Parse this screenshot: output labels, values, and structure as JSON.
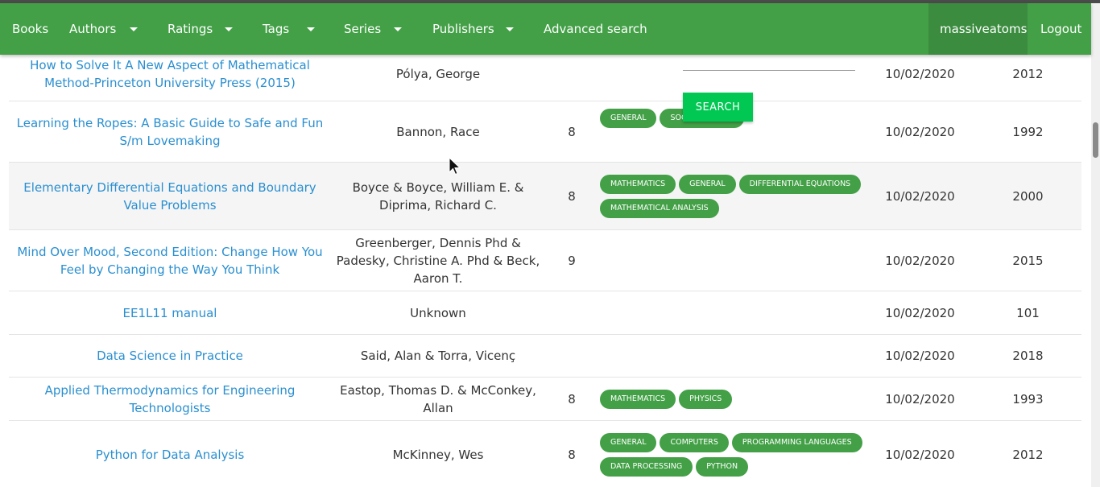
{
  "nav": {
    "books": "Books",
    "authors": "Authors",
    "ratings": "Ratings",
    "tags": "Tags",
    "series": "Series",
    "publishers": "Publishers",
    "advanced_search": "Advanced search",
    "user": "massiveatoms",
    "logout": "Logout"
  },
  "search": {
    "button_label": "SEARCH"
  },
  "books": [
    {
      "title": "How to Solve It A New Aspect of Mathematical Method-Princeton University Press (2015)",
      "author": "Pólya, George",
      "rating": "",
      "tags": [],
      "date": "10/02/2020",
      "year": "2012"
    },
    {
      "title": "Learning the Ropes: A Basic Guide to Safe and Fun S/m Lovemaking",
      "author": "Bannon, Race",
      "rating": "8",
      "tags": [
        "GENERAL",
        "SOCIAL SCIENCE"
      ],
      "date": "10/02/2020",
      "year": "1992"
    },
    {
      "title": "Elementary Differential Equations and Boundary Value Problems",
      "author": "Boyce & Boyce, William E. & Diprima, Richard C.",
      "rating": "8",
      "tags": [
        "MATHEMATICS",
        "GENERAL",
        "DIFFERENTIAL EQUATIONS",
        "MATHEMATICAL ANALYSIS"
      ],
      "date": "10/02/2020",
      "year": "2000"
    },
    {
      "title": "Mind Over Mood, Second Edition: Change How You Feel by Changing the Way You Think",
      "author": "Greenberger, Dennis Phd & Padesky, Christine A. Phd & Beck, Aaron T.",
      "rating": "9",
      "tags": [],
      "date": "10/02/2020",
      "year": "2015"
    },
    {
      "title": "EE1L11 manual",
      "author": "Unknown",
      "rating": "",
      "tags": [],
      "date": "10/02/2020",
      "year": "101"
    },
    {
      "title": "Data Science in Practice",
      "author": "Said, Alan & Torra, Vicenç",
      "rating": "",
      "tags": [],
      "date": "10/02/2020",
      "year": "2018"
    },
    {
      "title": "Applied Thermodynamics for Engineering Technologists",
      "author": "Eastop, Thomas D. & McConkey, Allan",
      "rating": "8",
      "tags": [
        "MATHEMATICS",
        "PHYSICS"
      ],
      "date": "10/02/2020",
      "year": "1993"
    },
    {
      "title": "Python for Data Analysis",
      "author": "McKinney, Wes",
      "rating": "8",
      "tags": [
        "GENERAL",
        "COMPUTERS",
        "PROGRAMMING LANGUAGES",
        "DATA PROCESSING",
        "PYTHON"
      ],
      "date": "10/02/2020",
      "year": "2012"
    }
  ]
}
